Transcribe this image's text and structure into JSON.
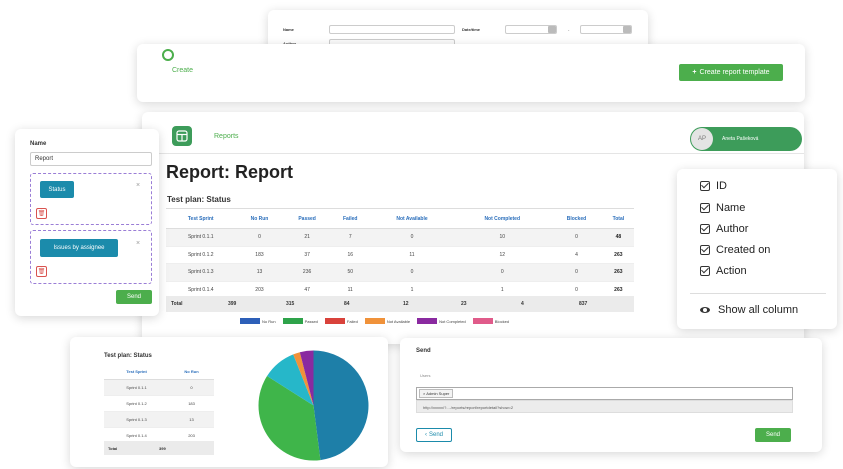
{
  "form_card": {
    "name_label": "Name",
    "author_label": "Author",
    "date_label": "Date/time",
    "dash": "-"
  },
  "create_card": {
    "create_label": "Create",
    "template_button": "Create report template",
    "plus_icon": "plus-icon"
  },
  "header": {
    "nav_label": "Reports",
    "user_initials": "AP",
    "user_name": "Aneta Pašeková"
  },
  "report": {
    "title": "Report: Report",
    "plan_title": "Test plan: Status",
    "columns": [
      "Test Sprint",
      "No Run",
      "Passed",
      "Failed",
      "Not Available",
      "Not Completed",
      "Blocked",
      "Total"
    ],
    "rows": [
      [
        "Sprint 0.1.1",
        "0",
        "21",
        "7",
        "0",
        "10",
        "0",
        "48"
      ],
      [
        "Sprint 0.1.2",
        "183",
        "37",
        "16",
        "11",
        "12",
        "4",
        "263"
      ],
      [
        "Sprint 0.1.3",
        "13",
        "236",
        "50",
        "0",
        "0",
        "0",
        "263"
      ],
      [
        "Sprint 0.1.4",
        "203",
        "47",
        "11",
        "1",
        "1",
        "0",
        "263"
      ]
    ],
    "total_row": [
      "Total",
      "399",
      "315",
      "84",
      "12",
      "23",
      "4",
      "837"
    ],
    "legend": [
      {
        "label": "No Run",
        "color": "#2d5fb8"
      },
      {
        "label": "Passed",
        "color": "#2ea34a"
      },
      {
        "label": "Failed",
        "color": "#d9423b"
      },
      {
        "label": "Not Available",
        "color": "#f0923a"
      },
      {
        "label": "Not Completed",
        "color": "#8a2aa0"
      },
      {
        "label": "Blocked",
        "color": "#e05b8a"
      }
    ]
  },
  "widget_panel": {
    "name_label": "Name",
    "name_value": "Report",
    "widget1": "Status",
    "widget2": "Issues by assignee",
    "close_glyph": "×",
    "delete_glyph": "🗑",
    "send_button": "Send"
  },
  "columns_panel": {
    "items": [
      "ID",
      "Name",
      "Author",
      "Created on",
      "Action"
    ],
    "show_all": "Show all column"
  },
  "small_plan": {
    "title": "Test plan: Status",
    "columns": [
      "Test Sprint",
      "No Run"
    ],
    "rows": [
      [
        "Sprint 0.1.1",
        "0"
      ],
      [
        "Sprint 0.1.2",
        "183"
      ],
      [
        "Sprint 0.1.3",
        "13"
      ],
      [
        "Sprint 0.1.4",
        "203"
      ]
    ],
    "total_label": "Total",
    "total_value": "399",
    "pie": [
      {
        "value": 0.48,
        "color": "#1e7fa8"
      },
      {
        "value": 0.36,
        "color": "#3fb54a"
      },
      {
        "value": 0.1,
        "color": "#26b7c9"
      },
      {
        "value": 0.02,
        "color": "#f0923a"
      },
      {
        "value": 0.04,
        "color": "#8a2aa0"
      }
    ]
  },
  "send_panel": {
    "title": "Send",
    "users_label": "Users",
    "user_tag": "× Admin Super",
    "url": "http://xxxxx/?..../reports/report/reportdetail?show=2",
    "back_button": "Send",
    "send_button": "Send"
  }
}
